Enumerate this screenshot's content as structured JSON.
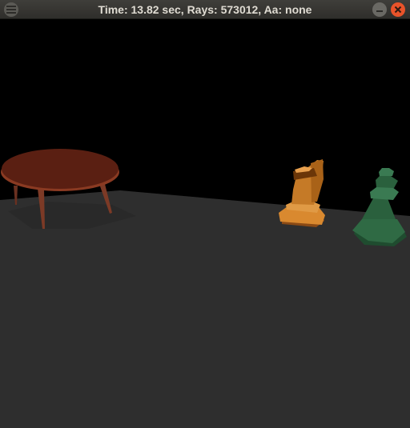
{
  "window": {
    "title": "Time: 13.82 sec, Rays: 573012, Aa: none",
    "menu_icon": "hamburger-icon",
    "minimize_icon": "minimize-icon",
    "close_icon": "close-icon",
    "close_color": "#e9532a"
  },
  "scene": {
    "background_color": "#000000",
    "floor_color": "#2e2e2e",
    "table_color": "#5a1f12",
    "knight_color": "#d9892f",
    "pawn_color": "#2f6a44"
  }
}
